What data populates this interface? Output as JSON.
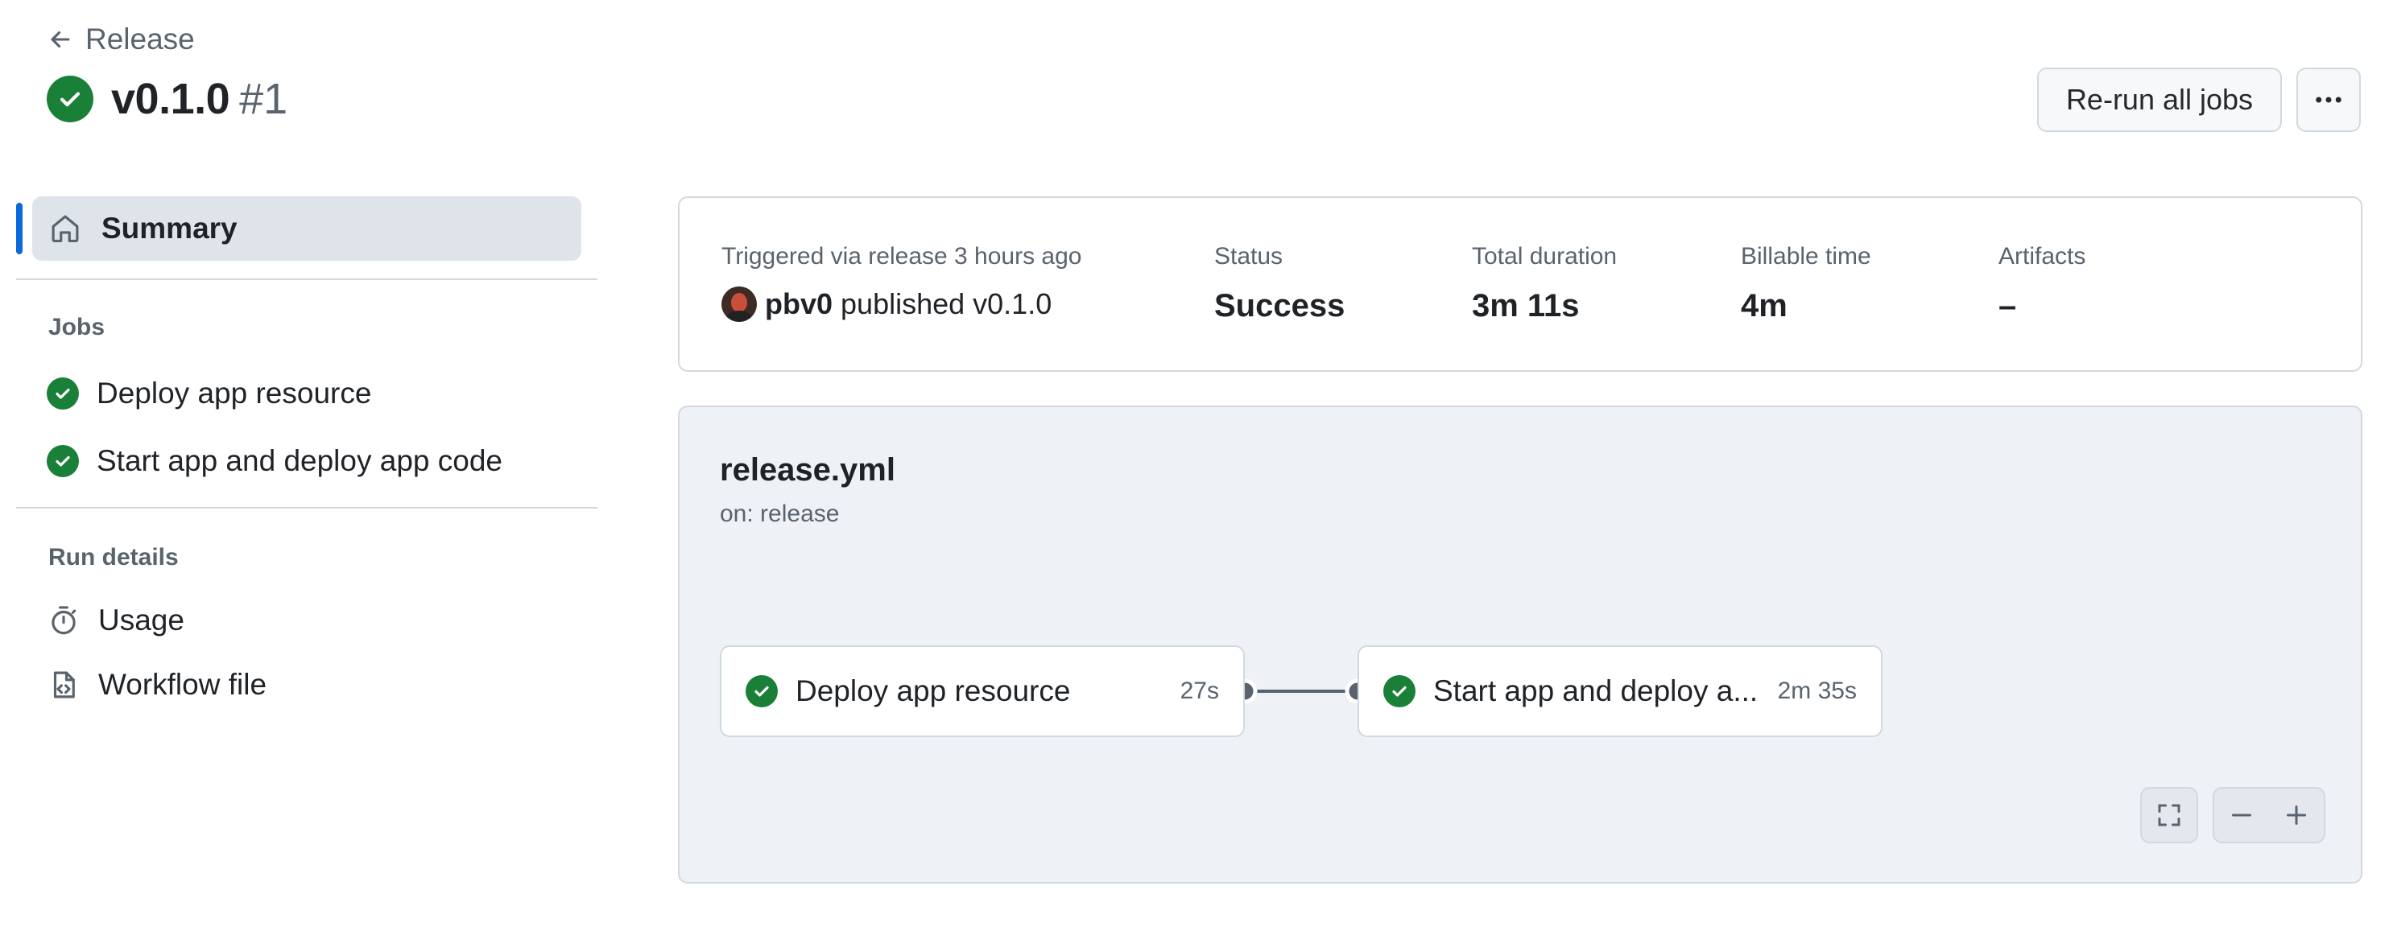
{
  "header": {
    "back_label": "Release",
    "title": "v0.1.0",
    "run_number": "#1",
    "rerun_label": "Re-run all jobs"
  },
  "sidebar": {
    "summary_label": "Summary",
    "jobs_heading": "Jobs",
    "jobs": [
      {
        "label": "Deploy app resource"
      },
      {
        "label": "Start app and deploy app code"
      }
    ],
    "run_details_heading": "Run details",
    "run_details": [
      {
        "label": "Usage",
        "icon": "stopwatch-icon"
      },
      {
        "label": "Workflow file",
        "icon": "file-code-icon"
      }
    ]
  },
  "summary": {
    "trigger_label": "Triggered via release 3 hours ago",
    "trigger_user": "pbv0",
    "trigger_action": "published v0.1.0",
    "status_label": "Status",
    "status_value": "Success",
    "duration_label": "Total duration",
    "duration_value": "3m 11s",
    "billable_label": "Billable time",
    "billable_value": "4m",
    "artifacts_label": "Artifacts",
    "artifacts_value": "–"
  },
  "workflow": {
    "file": "release.yml",
    "trigger": "on: release",
    "jobs": [
      {
        "name": "Deploy app resource",
        "time": "27s"
      },
      {
        "name": "Start app and deploy a...",
        "time": "2m 35s"
      }
    ]
  },
  "colors": {
    "success": "#1a7f37",
    "accent": "#0969da"
  }
}
